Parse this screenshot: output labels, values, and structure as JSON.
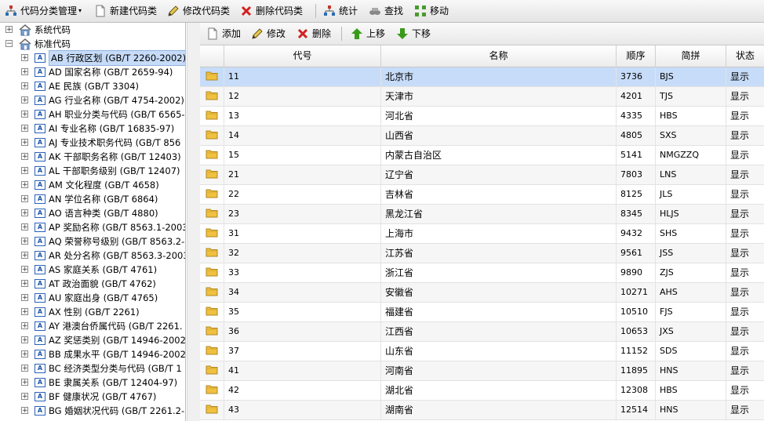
{
  "toolbar": {
    "category_menu": "代码分类管理",
    "new_category": "新建代码类",
    "edit_category": "修改代码类",
    "delete_category": "删除代码类",
    "statistics": "统计",
    "search": "查找",
    "move": "移动"
  },
  "tree": {
    "system_codes": "系统代码",
    "standard_codes": "标准代码",
    "items": [
      {
        "label": "AB 行政区划 (GB/T 2260-2002)",
        "selected": true
      },
      {
        "label": "AD 国家名称 (GB/T 2659-94)"
      },
      {
        "label": "AE 民族 (GB/T 3304)"
      },
      {
        "label": "AG 行业名称 (GB/T 4754-2002)"
      },
      {
        "label": "AH 职业分类与代码 (GB/T 6565-"
      },
      {
        "label": "AI 专业名称 (GB/T 16835-97)"
      },
      {
        "label": "AJ 专业技术职务代码 (GB/T 856"
      },
      {
        "label": "AK 干部职务名称 (GB/T 12403)"
      },
      {
        "label": "AL 干部职务级别 (GB/T 12407)"
      },
      {
        "label": "AM 文化程度 (GB/T 4658)"
      },
      {
        "label": "AN 学位名称 (GB/T 6864)"
      },
      {
        "label": "AO 语言种类 (GB/T 4880)"
      },
      {
        "label": "AP 奖励名称 (GB/T 8563.1-2003"
      },
      {
        "label": "AQ 荣誉称号级别 (GB/T 8563.2-"
      },
      {
        "label": "AR 处分名称 (GB/T 8563.3-2003"
      },
      {
        "label": "AS 家庭关系 (GB/T 4761)"
      },
      {
        "label": "AT 政治面貌 (GB/T 4762)"
      },
      {
        "label": "AU 家庭出身 (GB/T 4765)"
      },
      {
        "label": "AX 性别 (GB/T 2261)"
      },
      {
        "label": "AY 港澳台侨属代码 (GB/T 2261."
      },
      {
        "label": "AZ 奖惩类别 (GB/T 14946-2002)"
      },
      {
        "label": "BB 成果水平 (GB/T 14946-2002)"
      },
      {
        "label": "BC 经济类型分类与代码 (GB/T 1"
      },
      {
        "label": "BE 隶属关系 (GB/T 12404-97)"
      },
      {
        "label": "BF 健康状况 (GB/T 4767)"
      },
      {
        "label": "BG 婚姻状况代码 (GB/T 2261.2-"
      }
    ]
  },
  "grid_toolbar": {
    "add": "添加",
    "edit": "修改",
    "delete": "删除",
    "move_up": "上移",
    "move_down": "下移"
  },
  "grid": {
    "columns": [
      "代号",
      "名称",
      "顺序",
      "简拼",
      "状态"
    ],
    "rows": [
      {
        "code": "11",
        "name": "北京市",
        "order": "3736",
        "pinyin": "BJS",
        "status": "显示",
        "selected": true
      },
      {
        "code": "12",
        "name": "天津市",
        "order": "4201",
        "pinyin": "TJS",
        "status": "显示"
      },
      {
        "code": "13",
        "name": "河北省",
        "order": "4335",
        "pinyin": "HBS",
        "status": "显示"
      },
      {
        "code": "14",
        "name": "山西省",
        "order": "4805",
        "pinyin": "SXS",
        "status": "显示"
      },
      {
        "code": "15",
        "name": "内蒙古自治区",
        "order": "5141",
        "pinyin": "NMGZZQ",
        "status": "显示"
      },
      {
        "code": "21",
        "name": "辽宁省",
        "order": "7803",
        "pinyin": "LNS",
        "status": "显示"
      },
      {
        "code": "22",
        "name": "吉林省",
        "order": "8125",
        "pinyin": "JLS",
        "status": "显示"
      },
      {
        "code": "23",
        "name": "黑龙江省",
        "order": "8345",
        "pinyin": "HLJS",
        "status": "显示"
      },
      {
        "code": "31",
        "name": "上海市",
        "order": "9432",
        "pinyin": "SHS",
        "status": "显示"
      },
      {
        "code": "32",
        "name": "江苏省",
        "order": "9561",
        "pinyin": "JSS",
        "status": "显示"
      },
      {
        "code": "33",
        "name": "浙江省",
        "order": "9890",
        "pinyin": "ZJS",
        "status": "显示"
      },
      {
        "code": "34",
        "name": "安徽省",
        "order": "10271",
        "pinyin": "AHS",
        "status": "显示"
      },
      {
        "code": "35",
        "name": "福建省",
        "order": "10510",
        "pinyin": "FJS",
        "status": "显示"
      },
      {
        "code": "36",
        "name": "江西省",
        "order": "10653",
        "pinyin": "JXS",
        "status": "显示"
      },
      {
        "code": "37",
        "name": "山东省",
        "order": "11152",
        "pinyin": "SDS",
        "status": "显示"
      },
      {
        "code": "41",
        "name": "河南省",
        "order": "11895",
        "pinyin": "HNS",
        "status": "显示"
      },
      {
        "code": "42",
        "name": "湖北省",
        "order": "12308",
        "pinyin": "HBS",
        "status": "显示"
      },
      {
        "code": "43",
        "name": "湖南省",
        "order": "12514",
        "pinyin": "HNS",
        "status": "显示"
      }
    ]
  },
  "colors": {
    "selected_row": "#c7dcf8",
    "delete_red": "#d42020",
    "up_down_green": "#3a9a1a",
    "folder_yellow": "#f0c040"
  }
}
